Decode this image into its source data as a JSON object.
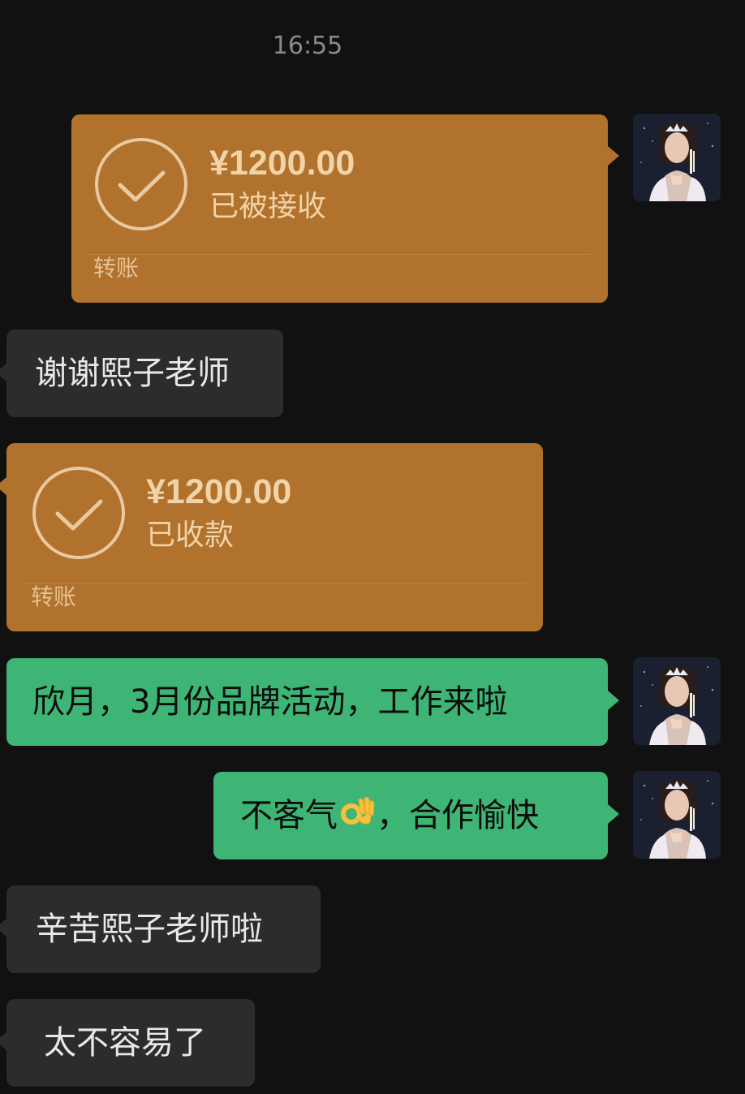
{
  "chat": {
    "timestamp": "16:55",
    "messages": [
      {
        "type": "transfer",
        "side": "sent",
        "amount": "¥1200.00",
        "status": "已被接收",
        "kind": "转账"
      },
      {
        "type": "text",
        "side": "received",
        "text": "谢谢熙子老师"
      },
      {
        "type": "transfer",
        "side": "received",
        "amount": "¥1200.00",
        "status": "已收款",
        "kind": "转账"
      },
      {
        "type": "text",
        "side": "sent",
        "text": "欣月，3月份品牌活动，工作来啦"
      },
      {
        "type": "text",
        "side": "sent",
        "text_before": "不客气",
        "emoji": "ok-hand-emoji",
        "text_after": "，合作愉快"
      },
      {
        "type": "text",
        "side": "received",
        "text": "辛苦熙子老师啦"
      },
      {
        "type": "text",
        "side": "received",
        "text": "太不容易了"
      }
    ]
  },
  "colors": {
    "background": "#111111",
    "transfer_bubble": "#b0722d",
    "sent_bubble": "#3eb575",
    "received_bubble": "#2c2c2c"
  }
}
